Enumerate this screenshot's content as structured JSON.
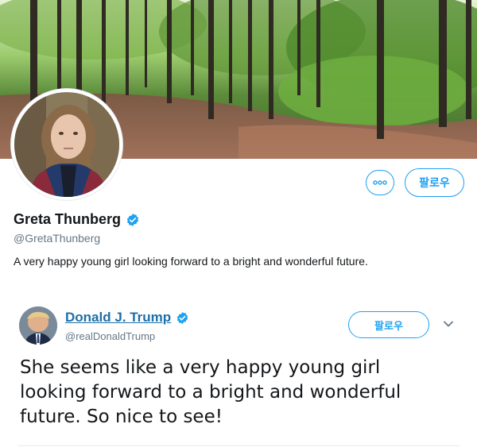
{
  "profile": {
    "name": "Greta Thunberg",
    "handle": "@GretaThunberg",
    "bio": "A very happy young girl looking forward to a bright and wonderful future.",
    "verified": true,
    "follow_label": "팔로우",
    "more_icon": "more-dots-icon"
  },
  "tweet": {
    "author_name": "Donald J. Trump",
    "author_handle": "@realDonaldTrump",
    "verified": true,
    "follow_label": "팔로우",
    "text": "She seems like a very happy young girl looking forward to a bright and wonderful future. So nice to see!",
    "caret_icon": "chevron-down-icon"
  },
  "colors": {
    "accent": "#1da1f2",
    "name_link": "#1b6fa8",
    "secondary_text": "#657786",
    "primary_text": "#14171a"
  }
}
